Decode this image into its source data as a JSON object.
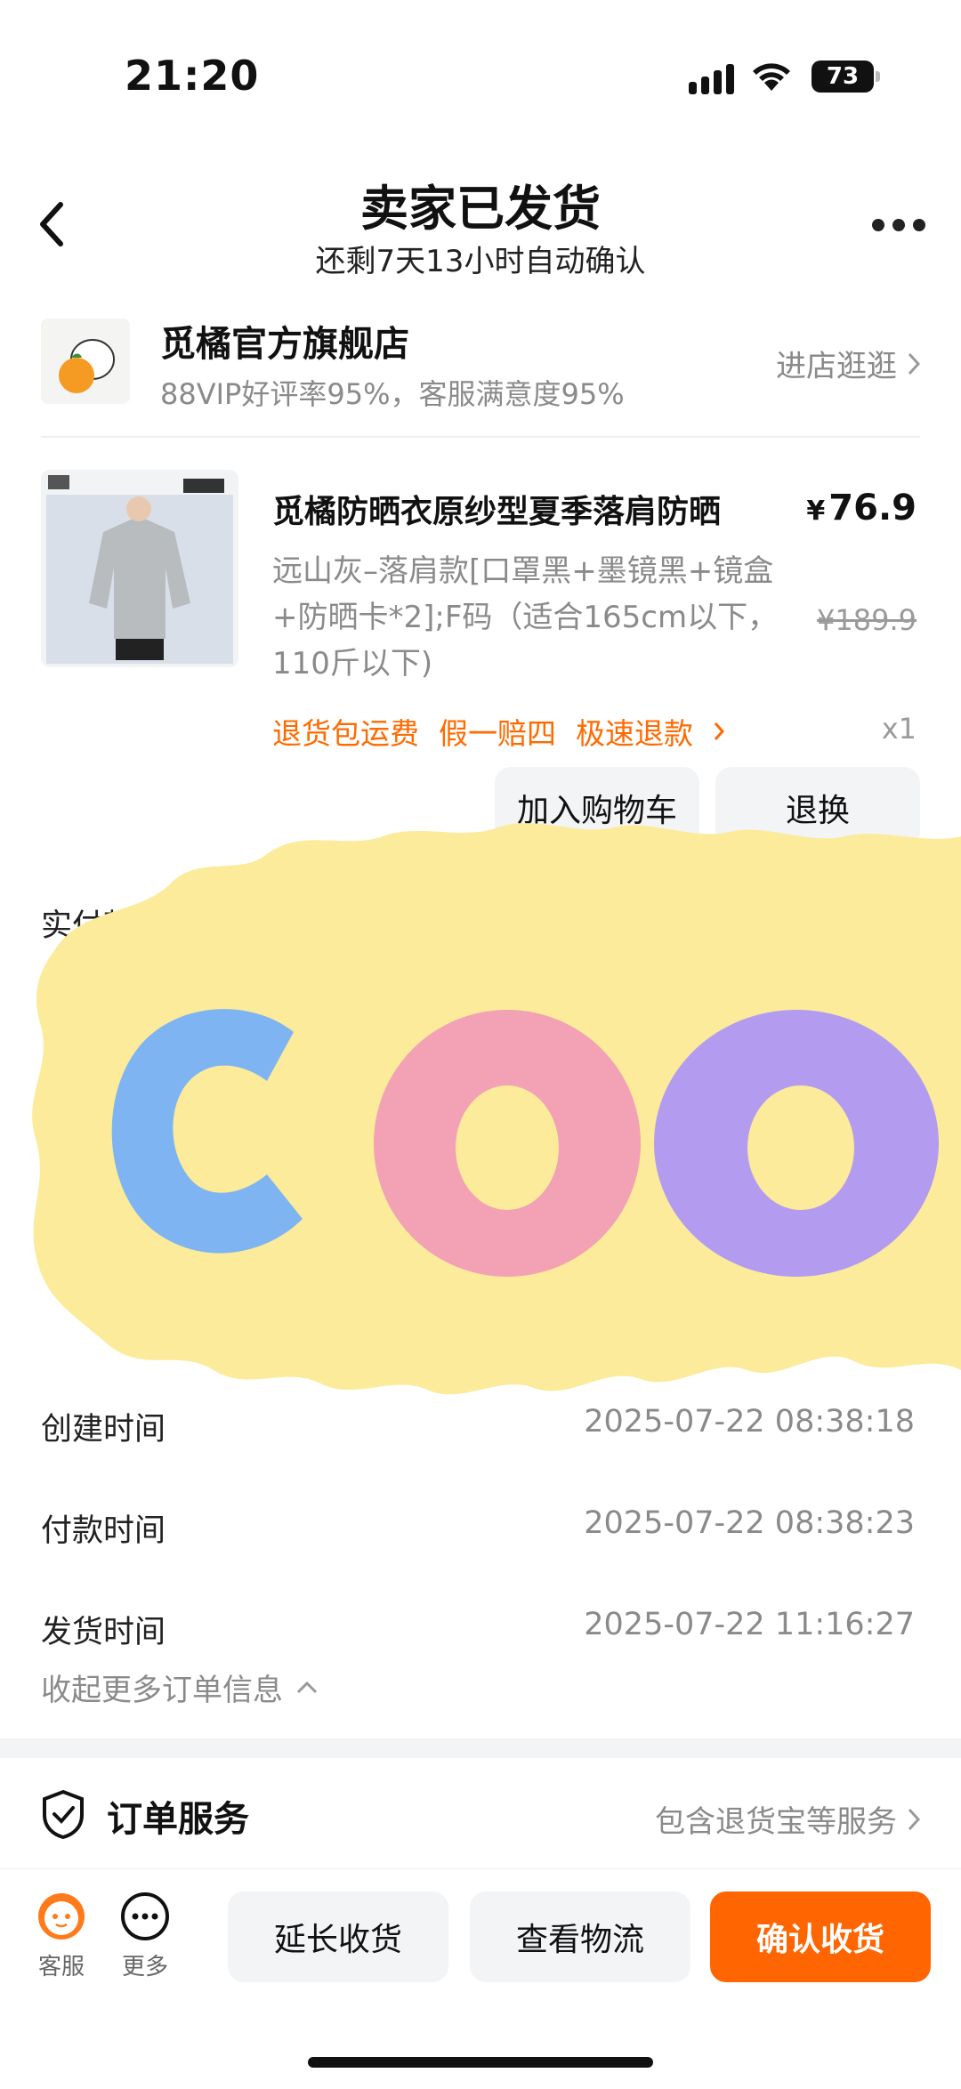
{
  "status_bar": {
    "time": "21:20",
    "battery": "73"
  },
  "header": {
    "title": "卖家已发货",
    "subtitle": "还剩7天13小时自动确认"
  },
  "store": {
    "name": "觅橘官方旗舰店",
    "rating": "88VIP好评率95%，客服满意度95%",
    "link_label": "进店逛逛"
  },
  "product": {
    "title": "觅橘防晒衣原纱型夏季落肩防晒",
    "price_symbol": "¥",
    "price": "76.9",
    "specs": "远山灰–落肩款[口罩黑+墨镜黑+镜盒+防晒卡*2];F码（适合165cm以下，110斤以下)",
    "original_price": "¥189.9",
    "tags": [
      "退货包运费",
      "假一赔四",
      "极速退款"
    ],
    "quantity": "x1",
    "add_cart_label": "加入购物车",
    "return_label": "退换"
  },
  "order_info": {
    "paid_label": "实付款",
    "rows": [
      {
        "label": "创建时间",
        "value": "2025-07-22 08:38:18"
      },
      {
        "label": "付款时间",
        "value": "2025-07-22 08:38:23"
      },
      {
        "label": "发货时间",
        "value": "2025-07-22 11:16:27"
      }
    ],
    "collapse_label": "收起更多订单信息"
  },
  "order_service": {
    "title": "订单服务",
    "link_label": "包含退货宝等服务"
  },
  "bottom_bar": {
    "service_label": "客服",
    "more_label": "更多",
    "extend_label": "延长收货",
    "logistics_label": "查看物流",
    "confirm_label": "确认收货"
  },
  "colors": {
    "accent": "#ff6500",
    "tag": "#ff6a00"
  }
}
